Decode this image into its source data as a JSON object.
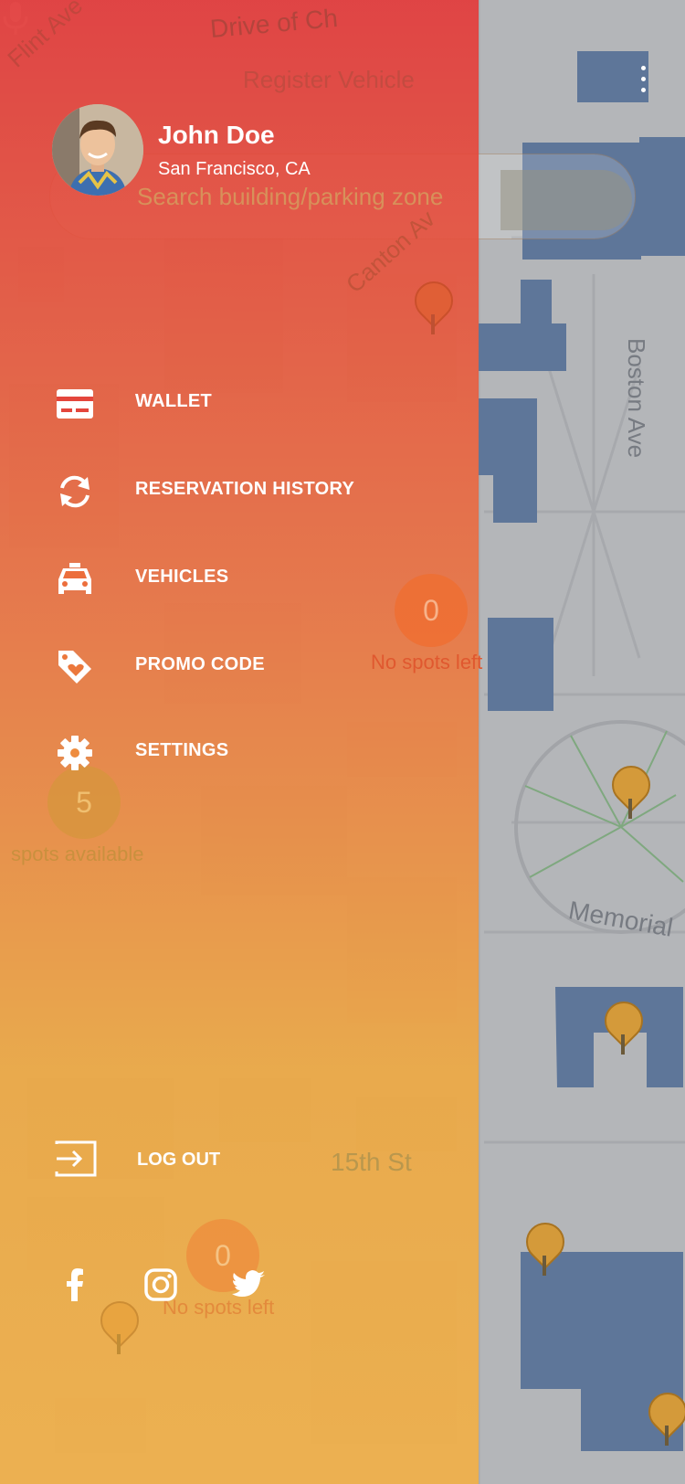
{
  "user": {
    "name": "John Doe",
    "location": "San Francisco, CA"
  },
  "menu": [
    {
      "label": "WALLET",
      "icon": "wallet-card-icon"
    },
    {
      "label": "RESERVATION HISTORY",
      "icon": "refresh-icon"
    },
    {
      "label": "VEHICLES",
      "icon": "car-icon"
    },
    {
      "label": "PROMO CODE",
      "icon": "tag-heart-icon"
    },
    {
      "label": "SETTINGS",
      "icon": "gear-icon"
    }
  ],
  "logout": {
    "label": "LOG OUT",
    "icon": "logout-icon"
  },
  "social": [
    "facebook-icon",
    "instagram-icon",
    "twitter-icon"
  ],
  "background": {
    "search_placeholder": "Search building/parking zone",
    "register_label": "Register Vehicle",
    "roads": {
      "boston": "Boston Ave",
      "memorial": "Memorial",
      "fifteenth": "15th St",
      "drive": "Drive of Ch",
      "canton": "Canton Av",
      "flint": "Flint Ave"
    },
    "spots": [
      {
        "count": "0",
        "caption": "No spots left"
      },
      {
        "count": "5",
        "caption": "spots available"
      },
      {
        "count": "0",
        "caption": "No spots left"
      }
    ]
  },
  "colors": {
    "drawer_top": "#e43838",
    "drawer_bottom": "#f2b046",
    "building_blue": "#5e7699",
    "map_gray": "#b4b6b9"
  }
}
